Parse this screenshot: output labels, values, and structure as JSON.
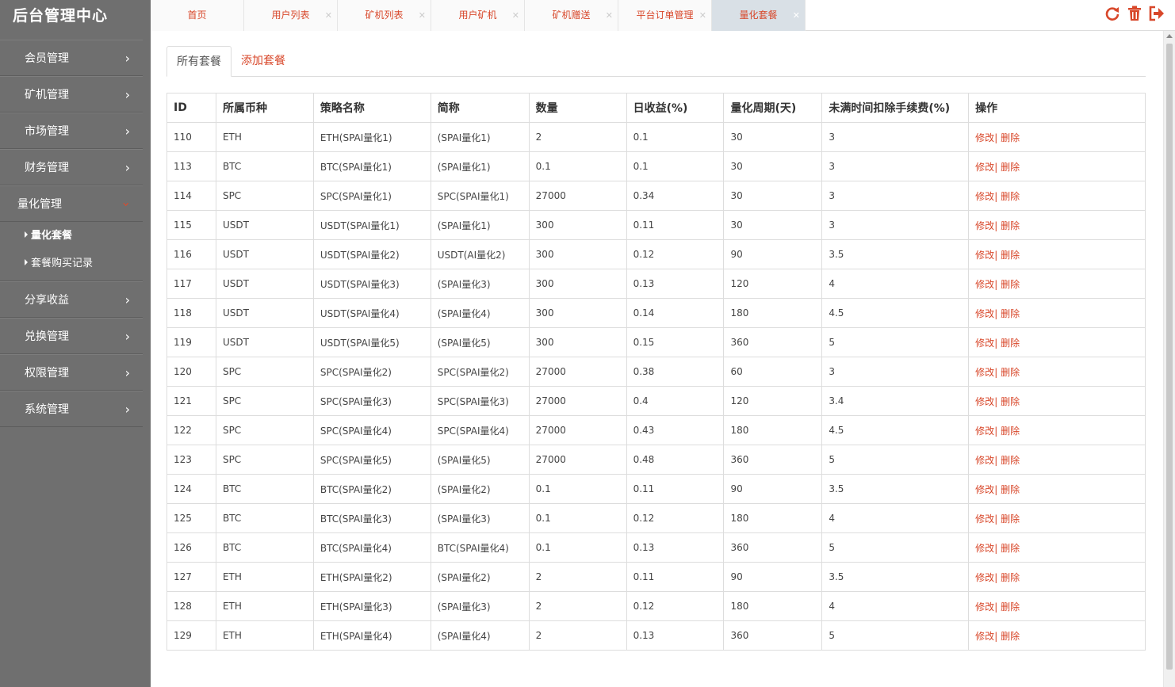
{
  "brand": "后台管理中心",
  "sidebar": {
    "items": [
      {
        "label": "会员管理"
      },
      {
        "label": "矿机管理"
      },
      {
        "label": "市场管理"
      },
      {
        "label": "财务管理"
      },
      {
        "label": "量化管理"
      },
      {
        "label": "分享收益"
      },
      {
        "label": "兑换管理"
      },
      {
        "label": "权限管理"
      },
      {
        "label": "系统管理"
      }
    ],
    "submenu": [
      {
        "label": "量化套餐"
      },
      {
        "label": "套餐购买记录"
      }
    ]
  },
  "tabs": [
    {
      "label": "首页"
    },
    {
      "label": "用户列表"
    },
    {
      "label": "矿机列表"
    },
    {
      "label": "用户矿机"
    },
    {
      "label": "矿机赠送"
    },
    {
      "label": "平台订单管理"
    },
    {
      "label": "量化套餐"
    }
  ],
  "top_icons": [
    "refresh-icon",
    "trash-icon",
    "logout-icon"
  ],
  "accent_color": "#d8472a",
  "subtabs": [
    {
      "label": "所有套餐"
    },
    {
      "label": "添加套餐"
    }
  ],
  "table": {
    "headers": [
      "ID",
      "所属币种",
      "策略名称",
      "简称",
      "数量",
      "日收益(%)",
      "量化周期(天)",
      "未满时间扣除手续费(%)",
      "操作"
    ],
    "edit_label": "修改",
    "sep": "|",
    "delete_label": "删除",
    "rows": [
      [
        "110",
        "ETH",
        "ETH(SPAI量化1)",
        "(SPAI量化1)",
        "2",
        "0.1",
        "30",
        "3"
      ],
      [
        "113",
        "BTC",
        "BTC(SPAI量化1)",
        "(SPAI量化1)",
        "0.1",
        "0.1",
        "30",
        "3"
      ],
      [
        "114",
        "SPC",
        "SPC(SPAI量化1)",
        "SPC(SPAI量化1)",
        "27000",
        "0.34",
        "30",
        "3"
      ],
      [
        "115",
        "USDT",
        "USDT(SPAI量化1)",
        "(SPAI量化1)",
        "300",
        "0.11",
        "30",
        "3"
      ],
      [
        "116",
        "USDT",
        "USDT(SPAI量化2)",
        "USDT(AI量化2)",
        "300",
        "0.12",
        "90",
        "3.5"
      ],
      [
        "117",
        "USDT",
        "USDT(SPAI量化3)",
        "(SPAI量化3)",
        "300",
        "0.13",
        "120",
        "4"
      ],
      [
        "118",
        "USDT",
        "USDT(SPAI量化4)",
        "(SPAI量化4)",
        "300",
        "0.14",
        "180",
        "4.5"
      ],
      [
        "119",
        "USDT",
        "USDT(SPAI量化5)",
        "(SPAI量化5)",
        "300",
        "0.15",
        "360",
        "5"
      ],
      [
        "120",
        "SPC",
        "SPC(SPAI量化2)",
        "SPC(SPAI量化2)",
        "27000",
        "0.38",
        "60",
        "3"
      ],
      [
        "121",
        "SPC",
        "SPC(SPAI量化3)",
        "SPC(SPAI量化3)",
        "27000",
        "0.4",
        "120",
        "3.4"
      ],
      [
        "122",
        "SPC",
        "SPC(SPAI量化4)",
        "SPC(SPAI量化4)",
        "27000",
        "0.43",
        "180",
        "4.5"
      ],
      [
        "123",
        "SPC",
        "SPC(SPAI量化5)",
        "(SPAI量化5)",
        "27000",
        "0.48",
        "360",
        "5"
      ],
      [
        "124",
        "BTC",
        "BTC(SPAI量化2)",
        "(SPAI量化2)",
        "0.1",
        "0.11",
        "90",
        "3.5"
      ],
      [
        "125",
        "BTC",
        "BTC(SPAI量化3)",
        "(SPAI量化3)",
        "0.1",
        "0.12",
        "180",
        "4"
      ],
      [
        "126",
        "BTC",
        "BTC(SPAI量化4)",
        "BTC(SPAI量化4)",
        "0.1",
        "0.13",
        "360",
        "5"
      ],
      [
        "127",
        "ETH",
        "ETH(SPAI量化2)",
        "(SPAI量化2)",
        "2",
        "0.11",
        "90",
        "3.5"
      ],
      [
        "128",
        "ETH",
        "ETH(SPAI量化3)",
        "(SPAI量化3)",
        "2",
        "0.12",
        "180",
        "4"
      ],
      [
        "129",
        "ETH",
        "ETH(SPAI量化4)",
        "(SPAI量化4)",
        "2",
        "0.13",
        "360",
        "5"
      ]
    ]
  }
}
